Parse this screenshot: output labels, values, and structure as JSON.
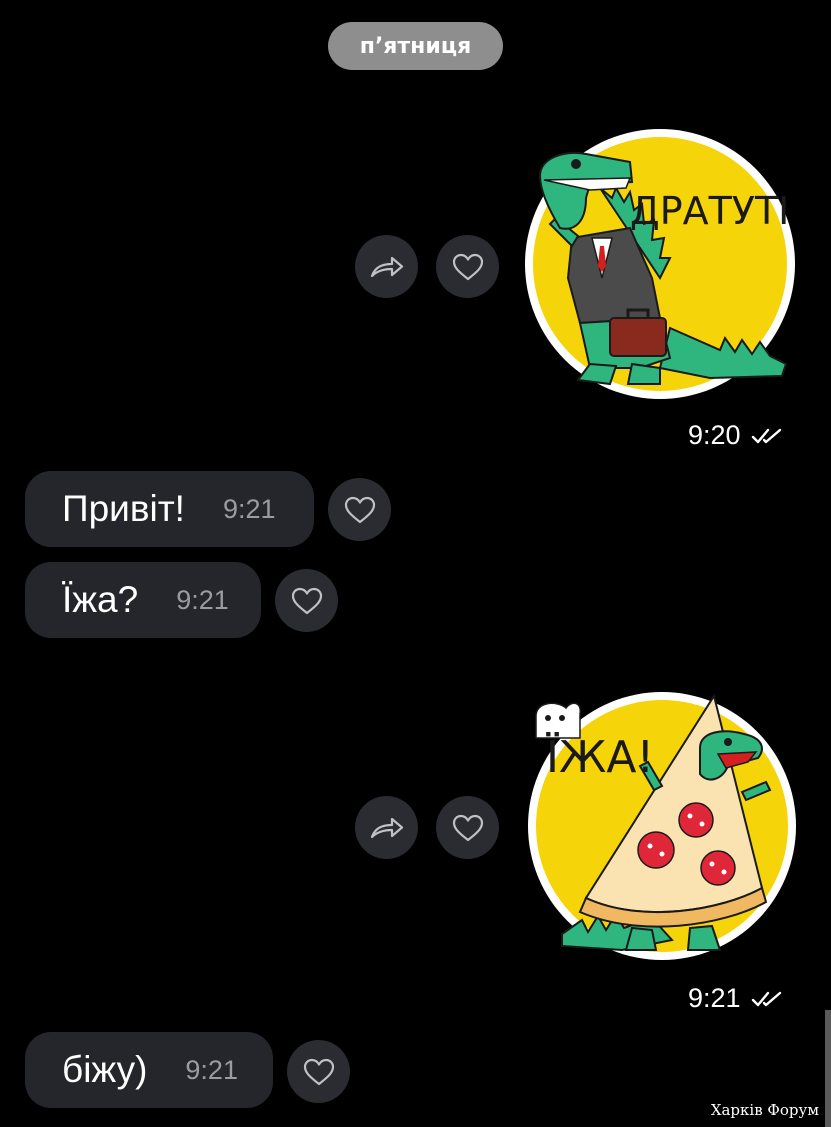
{
  "date_separator": "п’ятниця",
  "messages": [
    {
      "type": "sticker",
      "direction": "outgoing",
      "sticker_text": "ДРАТУТІ",
      "time": "9:20",
      "status": "read"
    },
    {
      "type": "text",
      "direction": "incoming",
      "text": "Привіт!",
      "time": "9:21"
    },
    {
      "type": "text",
      "direction": "incoming",
      "text": "Їжа?",
      "time": "9:21"
    },
    {
      "type": "sticker",
      "direction": "outgoing",
      "sticker_text": "ЇЖА!",
      "time": "9:21",
      "status": "read"
    },
    {
      "type": "text",
      "direction": "incoming",
      "text": "біжу)",
      "time": "9:21"
    }
  ],
  "icons": {
    "share": "share-arrow-icon",
    "like": "heart-outline-icon",
    "read_receipt": "double-check-icon"
  },
  "colors": {
    "background": "#000000",
    "bubble": "#24262b",
    "action_button": "#2a2c31",
    "date_pill": "#8e8e8e",
    "sticker_yellow": "#f6d40a",
    "dino_green": "#2fb57e"
  },
  "watermark": "Харків Форум"
}
